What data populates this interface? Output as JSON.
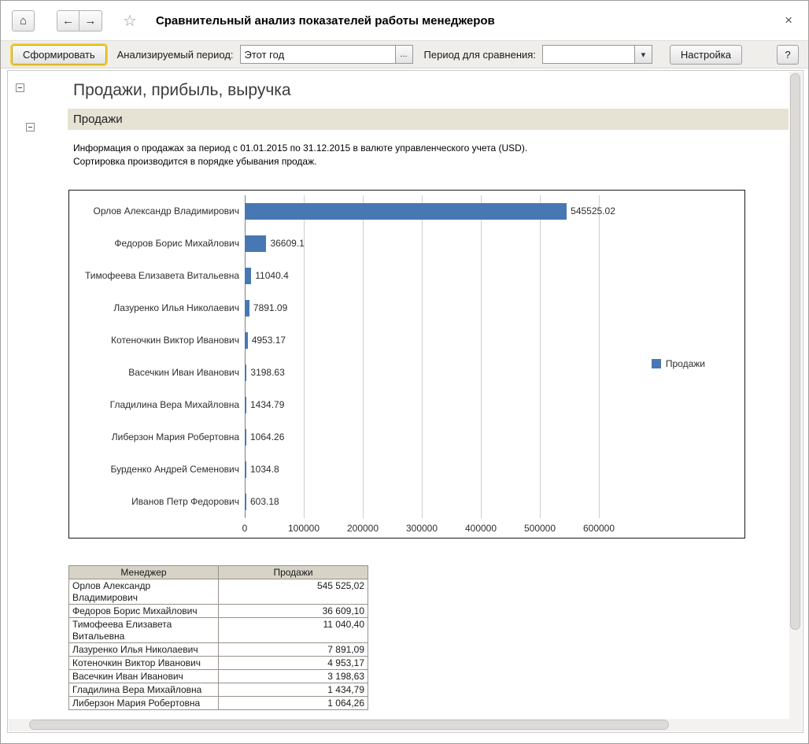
{
  "icons": {
    "home": "⌂",
    "back": "←",
    "forward": "→",
    "star": "☆",
    "close": "×",
    "dropdown": "▾",
    "ellipsis": "..."
  },
  "window": {
    "title": "Сравнительный анализ показателей работы менеджеров"
  },
  "toolbar": {
    "generate_button": "Сформировать",
    "period_label": "Анализируемый период:",
    "period_value": "Этот год",
    "compare_label": "Период для сравнения:",
    "compare_value": "",
    "settings_button": "Настройка",
    "help_button": "?"
  },
  "report": {
    "main_title": "Продажи, прибыль, выручка",
    "section_title": "Продажи",
    "info_line1": "Информация о продажах за период с 01.01.2015 по 31.12.2015 в валюте управленческого учета (USD).",
    "info_line2": "Сортировка производится в порядке убывания продаж."
  },
  "chart_data": {
    "type": "bar",
    "orientation": "horizontal",
    "title": "Продажи",
    "categories": [
      "Орлов Александр Владимирович",
      "Федоров Борис Михайлович",
      "Тимофеева Елизавета Витальевна",
      "Лазуренко Илья Николаевич",
      "Котеночкин Виктор Иванович",
      "Васечкин Иван Иванович",
      "Гладилина Вера Михайловна",
      "Либерзон Мария Робертовна",
      "Бурденко Андрей Семенович",
      "Иванов Петр Федорович"
    ],
    "values": [
      545525.02,
      36609.1,
      11040.4,
      7891.09,
      4953.17,
      3198.63,
      1434.79,
      1064.26,
      1034.8,
      603.18
    ],
    "value_labels": [
      "545525.02",
      "36609.1",
      "11040.4",
      "7891.09",
      "4953.17",
      "3198.63",
      "1434.79",
      "1064.26",
      "1034.8",
      "603.18"
    ],
    "x_ticks": [
      "0",
      "100000",
      "200000",
      "300000",
      "400000",
      "500000",
      "600000"
    ],
    "xlim": [
      0,
      600000
    ],
    "legend": "Продажи",
    "legend_position": "right",
    "grid": true,
    "bar_color": "#4878b4"
  },
  "table": {
    "columns": [
      "Менеджер",
      "Продажи"
    ],
    "rows": [
      [
        "Орлов Александр Владимирович",
        "545 525,02"
      ],
      [
        "Федоров Борис Михайлович",
        "36 609,10"
      ],
      [
        "Тимофеева Елизавета Витальевна",
        "11 040,40"
      ],
      [
        "Лазуренко Илья Николаевич",
        "7 891,09"
      ],
      [
        "Котеночкин Виктор Иванович",
        "4 953,17"
      ],
      [
        "Васечкин Иван Иванович",
        "3 198,63"
      ],
      [
        "Гладилина Вера Михайловна",
        "1 434,79"
      ],
      [
        "Либерзон Мария Робертовна",
        "1 064,26"
      ]
    ]
  }
}
